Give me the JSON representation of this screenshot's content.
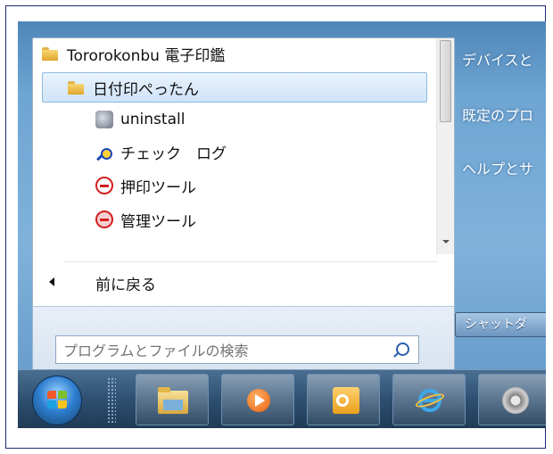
{
  "programs": {
    "items": [
      {
        "label": "Tororokonbu 電子印鑑",
        "icon": "folder-icon"
      },
      {
        "label": "日付印ぺったん",
        "icon": "folder-icon",
        "highlighted": true
      },
      {
        "label": "uninstall",
        "icon": "uninstall-icon"
      },
      {
        "label": "チェック　ログ",
        "icon": "check-log-icon"
      },
      {
        "label": "押印ツール",
        "icon": "stamp-icon"
      },
      {
        "label": "管理ツール",
        "icon": "admin-stamp-icon"
      }
    ],
    "back_label": "前に戻る"
  },
  "search": {
    "placeholder": "プログラムとファイルの検索",
    "icon": "search-icon"
  },
  "right_panel": {
    "items": [
      {
        "label": "デバイスと"
      },
      {
        "label": "既定のプロ"
      },
      {
        "label": "ヘルプとサ"
      }
    ],
    "shutdown_label": "シャットダ"
  },
  "taskbar": {
    "buttons": [
      {
        "icon": "file-explorer-icon"
      },
      {
        "icon": "media-player-icon"
      },
      {
        "icon": "outlook-icon"
      },
      {
        "icon": "internet-explorer-icon"
      },
      {
        "icon": "film-reel-icon"
      }
    ]
  },
  "colors": {
    "highlight": "#cfe4f8",
    "taskbar": "#2e4f70",
    "aero": "#6fa5d2"
  }
}
